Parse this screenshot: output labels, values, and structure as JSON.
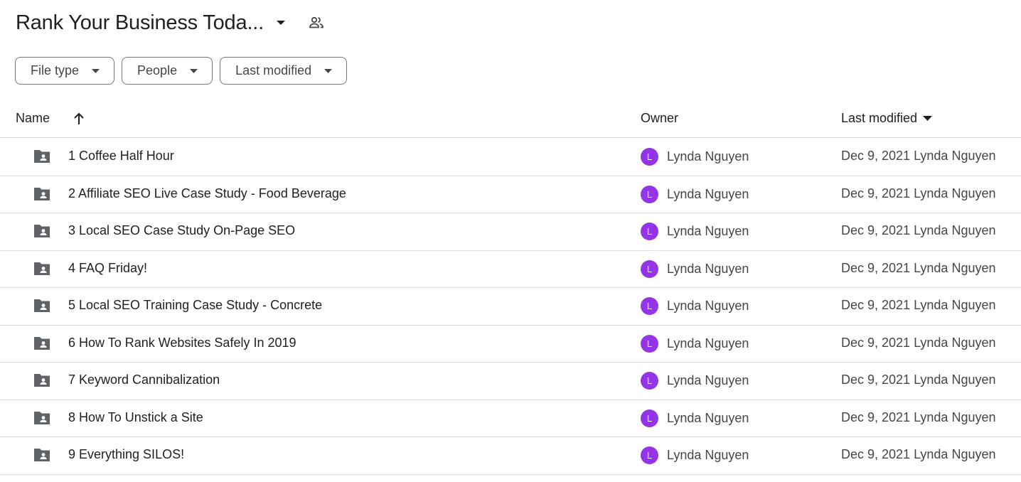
{
  "header": {
    "folder_title": "Rank Your Business Toda...",
    "title_dropdown_icon": "caret-down-icon",
    "shared_icon": "people-icon"
  },
  "filters": [
    {
      "label": "File type"
    },
    {
      "label": "People"
    },
    {
      "label": "Last modified"
    }
  ],
  "columns": {
    "name": "Name",
    "owner": "Owner",
    "last_modified": "Last modified",
    "sort_icon": "arrow-up-icon"
  },
  "colors": {
    "avatar": "#9334e6",
    "folder_icon": "#5f6368",
    "border": "#dadce0"
  },
  "rows": [
    {
      "name": "1 Coffee Half Hour",
      "owner_initial": "L",
      "owner": "Lynda Nguyen",
      "modified": "Dec 9, 2021 Lynda Nguyen"
    },
    {
      "name": "2 Affiliate SEO Live Case Study - Food Beverage",
      "owner_initial": "L",
      "owner": "Lynda Nguyen",
      "modified": "Dec 9, 2021 Lynda Nguyen"
    },
    {
      "name": "3 Local SEO Case Study On-Page SEO",
      "owner_initial": "L",
      "owner": "Lynda Nguyen",
      "modified": "Dec 9, 2021 Lynda Nguyen"
    },
    {
      "name": "4 FAQ Friday!",
      "owner_initial": "L",
      "owner": "Lynda Nguyen",
      "modified": "Dec 9, 2021 Lynda Nguyen"
    },
    {
      "name": "5 Local SEO Training Case Study - Concrete",
      "owner_initial": "L",
      "owner": "Lynda Nguyen",
      "modified": "Dec 9, 2021 Lynda Nguyen"
    },
    {
      "name": "6 How To Rank Websites Safely In 2019",
      "owner_initial": "L",
      "owner": "Lynda Nguyen",
      "modified": "Dec 9, 2021 Lynda Nguyen"
    },
    {
      "name": "7 Keyword Cannibalization",
      "owner_initial": "L",
      "owner": "Lynda Nguyen",
      "modified": "Dec 9, 2021 Lynda Nguyen"
    },
    {
      "name": "8 How To Unstick a Site",
      "owner_initial": "L",
      "owner": "Lynda Nguyen",
      "modified": "Dec 9, 2021 Lynda Nguyen"
    },
    {
      "name": "9 Everything SILOS!",
      "owner_initial": "L",
      "owner": "Lynda Nguyen",
      "modified": "Dec 9, 2021 Lynda Nguyen"
    }
  ]
}
